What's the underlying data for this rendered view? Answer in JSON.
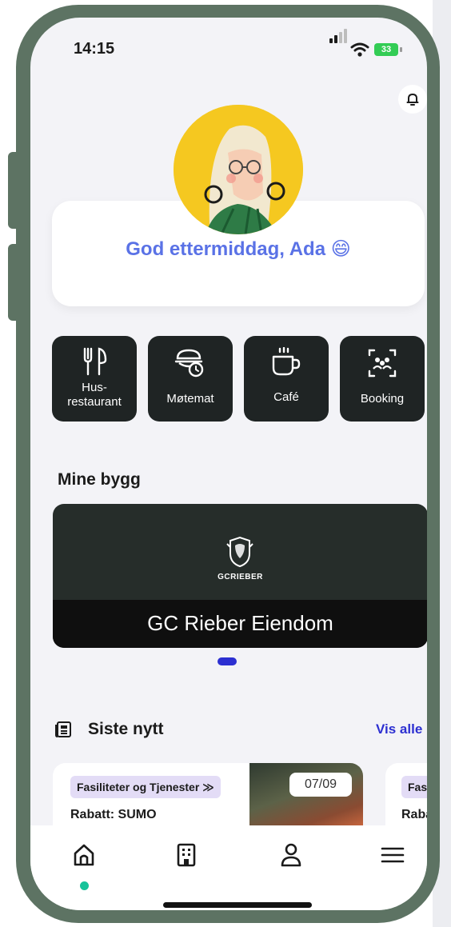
{
  "status_bar": {
    "time": "14:15",
    "battery": "33"
  },
  "greeting": {
    "text": "God ettermiddag, Ada 😄"
  },
  "quick_actions": [
    {
      "label": "Hus-\nrestaurant",
      "icon": "fork-knife-icon"
    },
    {
      "label": "Møtemat",
      "icon": "catering-clock-icon"
    },
    {
      "label": "Café",
      "icon": "coffee-cup-icon"
    },
    {
      "label": "Booking",
      "icon": "people-scan-icon"
    }
  ],
  "buildings": {
    "section_title": "Mine bygg",
    "logo_text": "GCRIEBER",
    "name": "GC Rieber Eiendom"
  },
  "news": {
    "section_title": "Siste nytt",
    "see_all": "Vis alle",
    "items": [
      {
        "category": "Fasiliteter og Tjenester ≫",
        "title": "Rabatt: SUMO",
        "date": "07/09"
      },
      {
        "category": "Fasilit",
        "title": "Rabat"
      }
    ]
  },
  "bottom_nav": [
    "home-icon",
    "building-icon",
    "profile-icon",
    "menu-icon"
  ],
  "colors": {
    "accent": "#2c2fd1",
    "greeting": "#5a72e6",
    "tile_bg": "#1f2424",
    "active_dot": "#16c39a",
    "chip_bg": "#e3dcf6"
  }
}
